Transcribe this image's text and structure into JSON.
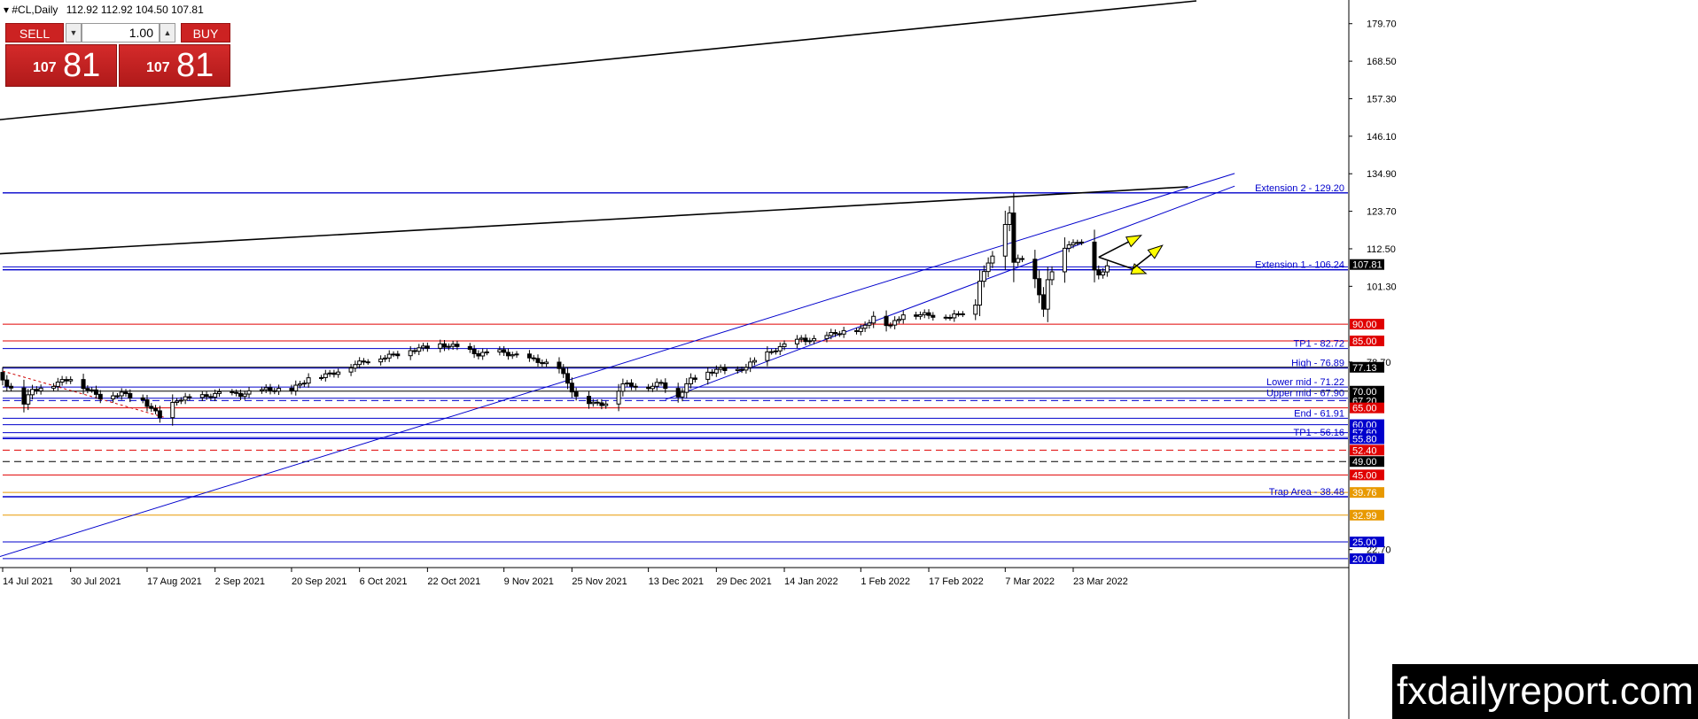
{
  "header": {
    "symbol": "#CL,Daily",
    "ohlc": "112.92 112.92 104.50 107.81"
  },
  "trade_panel": {
    "sell_label": "SELL",
    "buy_label": "BUY",
    "lot_value": "1.00",
    "sell_price_small": "107",
    "sell_price_big": "81",
    "buy_price_small": "107",
    "buy_price_big": "81"
  },
  "watermark": "fxdailyreport.com",
  "chart_data": {
    "type": "candlestick",
    "title": "#CL,Daily",
    "y_axis_ticks": [
      {
        "value": 179.7,
        "label": "179.70"
      },
      {
        "value": 168.5,
        "label": "168.50"
      },
      {
        "value": 157.3,
        "label": "157.30"
      },
      {
        "value": 146.1,
        "label": "146.10"
      },
      {
        "value": 134.9,
        "label": "134.90"
      },
      {
        "value": 123.7,
        "label": "123.70"
      },
      {
        "value": 112.5,
        "label": "112.50"
      },
      {
        "value": 101.3,
        "label": "101.30"
      },
      {
        "value": 78.7,
        "label": "78.70"
      },
      {
        "value": 22.7,
        "label": "22.70"
      }
    ],
    "ylim": [
      17.6,
      186.5
    ],
    "x_axis_ticks": [
      {
        "date": "2021-07-14",
        "label": "14 Jul 2021"
      },
      {
        "date": "2021-07-30",
        "label": "30 Jul 2021"
      },
      {
        "date": "2021-08-17",
        "label": "17 Aug 2021"
      },
      {
        "date": "2021-09-02",
        "label": "2 Sep 2021"
      },
      {
        "date": "2021-09-20",
        "label": "20 Sep 2021"
      },
      {
        "date": "2021-10-06",
        "label": "6 Oct 2021"
      },
      {
        "date": "2021-10-22",
        "label": "22 Oct 2021"
      },
      {
        "date": "2021-11-09",
        "label": "9 Nov 2021"
      },
      {
        "date": "2021-11-25",
        "label": "25 Nov 2021"
      },
      {
        "date": "2021-12-13",
        "label": "13 Dec 2021"
      },
      {
        "date": "2021-12-29",
        "label": "29 Dec 2021"
      },
      {
        "date": "2022-01-14",
        "label": "14 Jan 2022"
      },
      {
        "date": "2022-02-01",
        "label": "1 Feb 2022"
      },
      {
        "date": "2022-02-17",
        "label": "17 Feb 2022"
      },
      {
        "date": "2022-03-07",
        "label": "7 Mar 2022"
      },
      {
        "date": "2022-03-23",
        "label": "23 Mar 2022"
      }
    ],
    "price_path": [
      [
        "2021-07-13",
        75.0
      ],
      [
        "2021-07-15",
        72.0
      ],
      [
        "2021-07-19",
        66.5
      ],
      [
        "2021-07-21",
        70.3
      ],
      [
        "2021-07-26",
        72.0
      ],
      [
        "2021-07-30",
        73.9
      ],
      [
        "2021-08-03",
        70.5
      ],
      [
        "2021-08-06",
        68.3
      ],
      [
        "2021-08-11",
        69.3
      ],
      [
        "2021-08-16",
        67.3
      ],
      [
        "2021-08-20",
        62.3
      ],
      [
        "2021-08-24",
        67.5
      ],
      [
        "2021-08-31",
        68.5
      ],
      [
        "2021-09-03",
        69.3
      ],
      [
        "2021-09-08",
        69.0
      ],
      [
        "2021-09-14",
        70.5
      ],
      [
        "2021-09-20",
        70.3
      ],
      [
        "2021-09-24",
        73.9
      ],
      [
        "2021-09-29",
        75.0
      ],
      [
        "2021-10-04",
        77.5
      ],
      [
        "2021-10-08",
        79.3
      ],
      [
        "2021-10-13",
        80.5
      ],
      [
        "2021-10-19",
        82.5
      ],
      [
        "2021-10-25",
        83.8
      ],
      [
        "2021-10-29",
        83.3
      ],
      [
        "2021-11-03",
        81.0
      ],
      [
        "2021-11-08",
        81.8
      ],
      [
        "2021-11-12",
        80.5
      ],
      [
        "2021-11-17",
        79.0
      ],
      [
        "2021-11-22",
        76.8
      ],
      [
        "2021-11-26",
        68.2
      ],
      [
        "2021-11-30",
        66.2
      ],
      [
        "2021-12-03",
        66.3
      ],
      [
        "2021-12-07",
        72.0
      ],
      [
        "2021-12-13",
        71.3
      ],
      [
        "2021-12-16",
        72.4
      ],
      [
        "2021-12-20",
        68.5
      ],
      [
        "2021-12-23",
        73.5
      ],
      [
        "2021-12-29",
        76.5
      ],
      [
        "2022-01-03",
        76.0
      ],
      [
        "2022-01-07",
        78.9
      ],
      [
        "2022-01-12",
        82.6
      ],
      [
        "2022-01-18",
        85.5
      ],
      [
        "2022-01-21",
        85.1
      ],
      [
        "2022-01-26",
        87.4
      ],
      [
        "2022-02-01",
        88.2
      ],
      [
        "2022-02-04",
        92.3
      ],
      [
        "2022-02-08",
        89.4
      ],
      [
        "2022-02-11",
        93.1
      ],
      [
        "2022-02-16",
        92.8
      ],
      [
        "2022-02-22",
        92.3
      ],
      [
        "2022-02-24",
        92.8
      ],
      [
        "2022-02-28",
        95.7
      ],
      [
        "2022-03-01",
        103.4
      ],
      [
        "2022-03-03",
        107.7
      ],
      [
        "2022-03-07",
        119.4
      ],
      [
        "2022-03-08",
        123.7
      ],
      [
        "2022-03-09",
        108.7
      ],
      [
        "2022-03-11",
        109.3
      ],
      [
        "2022-03-14",
        103.0
      ],
      [
        "2022-03-16",
        95.0
      ],
      [
        "2022-03-17",
        102.9
      ],
      [
        "2022-03-21",
        112.1
      ],
      [
        "2022-03-23",
        114.9
      ],
      [
        "2022-03-25",
        113.9
      ],
      [
        "2022-03-28",
        105.9
      ],
      [
        "2022-03-29",
        104.2
      ],
      [
        "2022-03-31",
        107.8
      ]
    ],
    "horizontal_levels": [
      {
        "value": 129.2,
        "label": "Extension 2 - 129.20",
        "color": "#0000cc"
      },
      {
        "value": 107.1,
        "label": "",
        "color": "#0000cc"
      },
      {
        "value": 106.24,
        "label": "Extension 1 - 106.24",
        "color": "#0000cc"
      },
      {
        "value": 90.0,
        "label": "",
        "color": "#e00000"
      },
      {
        "value": 85.0,
        "label": "",
        "color": "#e00000"
      },
      {
        "value": 82.72,
        "label": "TP1 - 82.72",
        "color": "#0000cc"
      },
      {
        "value": 77.13,
        "label": "",
        "color": "#000000"
      },
      {
        "value": 76.89,
        "label": "High - 76.89",
        "color": "#0000cc"
      },
      {
        "value": 71.22,
        "label": "Lower mid - 71.22",
        "color": "#0000cc"
      },
      {
        "value": 70.0,
        "label": "",
        "color": "#000000"
      },
      {
        "value": 67.9,
        "label": "Upper mid - 67.90",
        "color": "#0000cc"
      },
      {
        "value": 67.2,
        "label": "",
        "color": "#0000cc"
      },
      {
        "value": 65.0,
        "label": "",
        "color": "#e00000"
      },
      {
        "value": 61.91,
        "label": "End - 61.91",
        "color": "#0000cc"
      },
      {
        "value": 60.0,
        "label": "",
        "color": "#0000cc"
      },
      {
        "value": 57.6,
        "label": "",
        "color": "#0000cc"
      },
      {
        "value": 56.16,
        "label": "TP1 - 56.16",
        "color": "#0000cc"
      },
      {
        "value": 55.8,
        "label": "",
        "color": "#0000cc"
      },
      {
        "value": 52.4,
        "label": "",
        "color": "#e00000"
      },
      {
        "value": 49.0,
        "label": "",
        "color": "#000000"
      },
      {
        "value": 45.0,
        "label": "",
        "color": "#e00000"
      },
      {
        "value": 39.76,
        "label": "",
        "color": "#e89900"
      },
      {
        "value": 38.48,
        "label": "Trap Area - 38.48",
        "color": "#0000cc"
      },
      {
        "value": 32.99,
        "label": "",
        "color": "#e89900"
      },
      {
        "value": 25.0,
        "label": "",
        "color": "#0000cc"
      },
      {
        "value": 20.0,
        "label": "",
        "color": "#0000cc"
      }
    ],
    "price_badges": [
      {
        "value": 107.81,
        "label": "107.81",
        "color": "#000000"
      },
      {
        "value": 90.0,
        "label": "90.00",
        "color": "#e00000"
      },
      {
        "value": 85.0,
        "label": "85.00",
        "color": "#e00000"
      },
      {
        "value": 77.13,
        "label": "77.13",
        "color": "#000000"
      },
      {
        "value": 70.0,
        "label": "70.00",
        "color": "#000000"
      },
      {
        "value": 67.2,
        "label": "67.20",
        "color": "#000000"
      },
      {
        "value": 65.0,
        "label": "65.00",
        "color": "#e00000"
      },
      {
        "value": 60.0,
        "label": "60.00",
        "color": "#0000cc"
      },
      {
        "value": 57.6,
        "label": "57.60",
        "color": "#0000cc"
      },
      {
        "value": 55.8,
        "label": "55.80",
        "color": "#0000cc"
      },
      {
        "value": 52.4,
        "label": "52.40",
        "color": "#e00000"
      },
      {
        "value": 49.0,
        "label": "49.00",
        "color": "#000000"
      },
      {
        "value": 45.0,
        "label": "45.00",
        "color": "#e00000"
      },
      {
        "value": 39.76,
        "label": "39.76",
        "color": "#e89900"
      },
      {
        "value": 32.99,
        "label": "32.99",
        "color": "#e89900"
      },
      {
        "value": 25.0,
        "label": "25.00",
        "color": "#0000cc"
      },
      {
        "value": 20.0,
        "label": "20.00",
        "color": "#0000cc"
      }
    ],
    "trend_lines": [
      {
        "name": "upper-channel-top",
        "color": "#000000",
        "from": [
          "2021-07-13",
          151.0
        ],
        "to": [
          "2022-04-21",
          186.5
        ]
      },
      {
        "name": "upper-channel-bottom",
        "color": "#000000",
        "from": [
          "2021-07-13",
          111.0
        ],
        "to": [
          "2022-04-19",
          131.0
        ]
      },
      {
        "name": "rising-support-long",
        "color": "#0000cc",
        "from": [
          "2021-07-13",
          20.5
        ],
        "to": [
          "2022-04-30",
          135.0
        ]
      },
      {
        "name": "rising-support-short",
        "color": "#0000cc",
        "from": [
          "2021-12-17",
          67.5
        ],
        "to": [
          "2022-04-30",
          131.2
        ]
      },
      {
        "name": "aug-dotted-decline",
        "color": "#cc0000",
        "from": [
          "2021-07-14",
          76.0
        ],
        "to": [
          "2021-08-21",
          62.2
        ]
      }
    ],
    "projection_arrows": [
      {
        "color": "#000000",
        "fill": "#ffff00",
        "points": [
          [
            "2022-03-29",
            110.0
          ],
          [
            "2022-04-08",
            116.5
          ]
        ]
      },
      {
        "color": "#000000",
        "fill": "#ffff00",
        "points": [
          [
            "2022-03-29",
            110.0
          ],
          [
            "2022-04-06",
            106.5
          ],
          [
            "2022-04-13",
            113.5
          ]
        ]
      }
    ],
    "colors": {
      "bull": "#ffffff",
      "bear": "#000000",
      "outline": "#000000"
    },
    "grid": false
  }
}
